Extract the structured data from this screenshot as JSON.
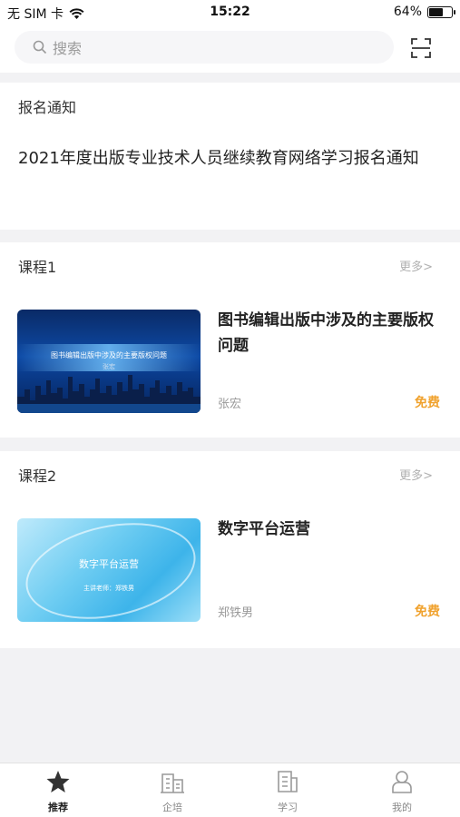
{
  "status_bar": {
    "carrier": "无 SIM 卡",
    "time": "15:22",
    "battery": "64%",
    "battery_level": 0.64
  },
  "search": {
    "placeholder": "搜索"
  },
  "notice": {
    "section_title": "报名通知",
    "text": "2021年度出版专业技术人员继续教育网络学习报名通知"
  },
  "courses": [
    {
      "section_title": "课程1",
      "more": "更多>",
      "title": "图书编辑出版中涉及的主要版权问题",
      "teacher": "张宏",
      "price": "免费",
      "thumb_text": "图书编辑出版中涉及的主要版权问题",
      "thumb_subtext": "张宏"
    },
    {
      "section_title": "课程2",
      "more": "更多>",
      "title": "数字平台运营",
      "teacher": "郑铁男",
      "price": "免费",
      "thumb_text": "数字平台运营",
      "thumb_subtext": "主讲老师：郑铁男"
    }
  ],
  "tabs": [
    {
      "label": "推荐",
      "icon": "star-icon"
    },
    {
      "label": "企培",
      "icon": "building-icon"
    },
    {
      "label": "学习",
      "icon": "study-icon"
    },
    {
      "label": "我的",
      "icon": "user-icon"
    }
  ],
  "colors": {
    "accent_price": "#f0a22e",
    "tab_active": "#222222"
  }
}
